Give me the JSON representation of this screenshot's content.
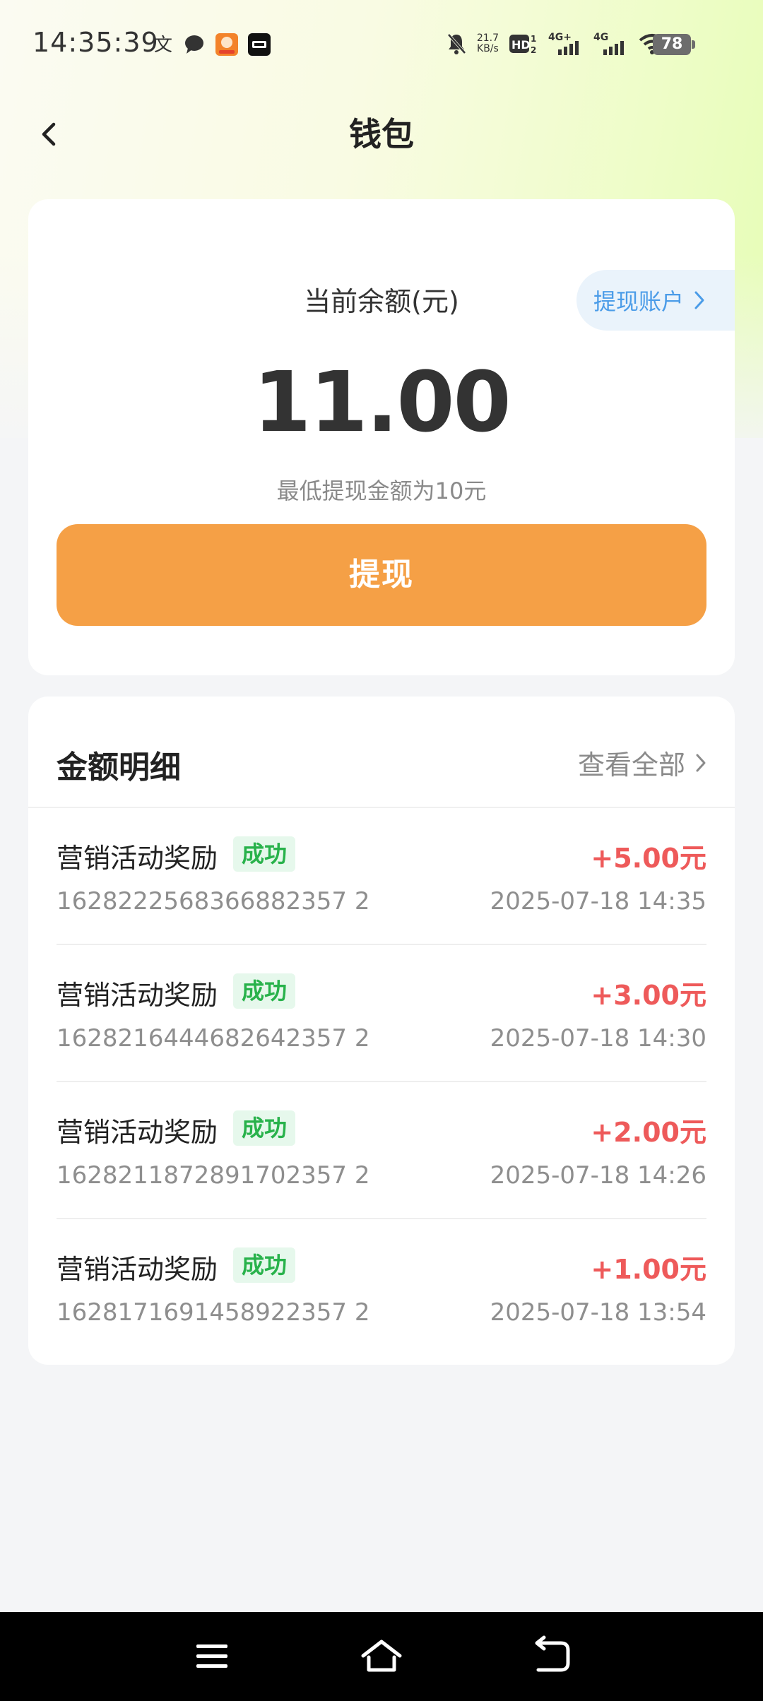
{
  "status_bar": {
    "time": "14:35:39",
    "net_speed_value": "21.7",
    "net_speed_unit": "KB/s",
    "hd_label": "HD",
    "signal_1": "4G+",
    "signal_2": "4G",
    "battery": "78",
    "left_icons": [
      "translate-icon",
      "chat-bubble-icon",
      "app-icon-orange",
      "app-icon-dark"
    ],
    "right_icons": [
      "mute-bell-icon",
      "hd-icon",
      "signal-icon",
      "signal-icon",
      "wifi-icon",
      "battery-icon"
    ]
  },
  "header": {
    "title": "钱包",
    "back_icon": "chevron-left-icon"
  },
  "balance_card": {
    "label": "当前余额(元)",
    "amount": "11.00",
    "min_note": "最低提现金额为10元",
    "withdraw_button": "提现",
    "withdraw_account_label": "提现账户",
    "accent_color": "#f5a046",
    "link_color": "#4b9ce8"
  },
  "details": {
    "title": "金额明细",
    "view_all": "查看全部",
    "items": [
      {
        "title": "营销活动奖励",
        "status": "成功",
        "id": "1628222568366882357 2",
        "amount": "+5.00元",
        "time": "2025-07-18 14:35"
      },
      {
        "title": "营销活动奖励",
        "status": "成功",
        "id": "1628216444682642357 2",
        "amount": "+3.00元",
        "time": "2025-07-18 14:30"
      },
      {
        "title": "营销活动奖励",
        "status": "成功",
        "id": "1628211872891702357 2",
        "amount": "+2.00元",
        "time": "2025-07-18 14:26"
      },
      {
        "title": "营销活动奖励",
        "status": "成功",
        "id": "1628171691458922357 2",
        "amount": "+1.00元",
        "time": "2025-07-18 13:54"
      }
    ],
    "amount_color": "#ee5a5a",
    "status_color": "#28b24b"
  },
  "system_nav": {
    "icons": [
      "menu-icon",
      "home-icon",
      "back-icon"
    ]
  }
}
